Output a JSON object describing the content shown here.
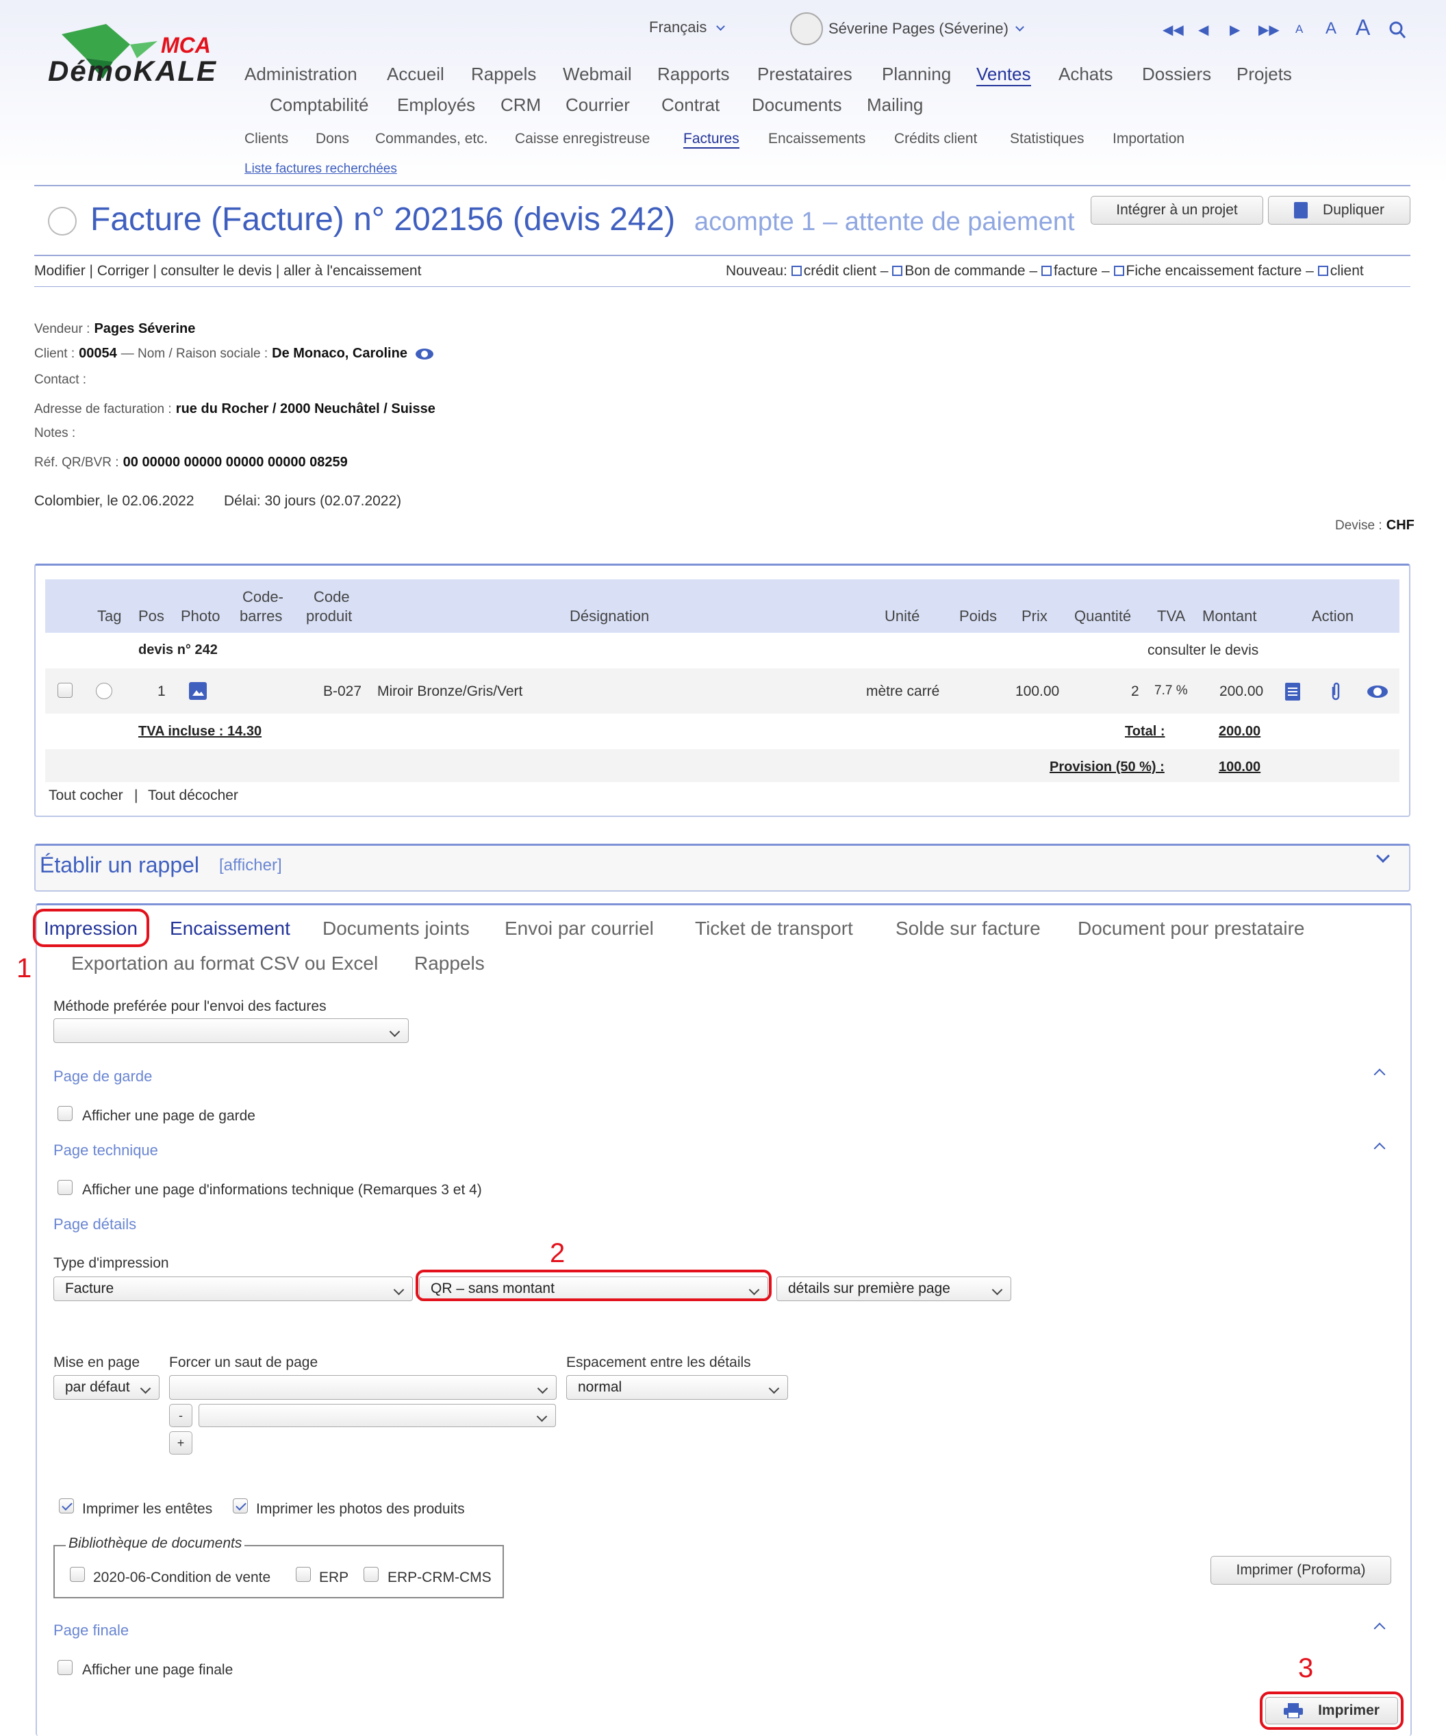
{
  "header": {
    "logo_text": "DémoKALE",
    "logo_badge": "MCA",
    "language": "Français",
    "user": "Séverine Pages (Séverine)",
    "font_sizes": [
      "A",
      "A",
      "A"
    ]
  },
  "main_nav": {
    "row1": [
      "Administration",
      "Accueil",
      "Rappels",
      "Webmail",
      "Rapports",
      "Prestataires",
      "Planning",
      "Ventes",
      "Achats",
      "Dossiers",
      "Projets"
    ],
    "row2": [
      "Comptabilité",
      "Employés",
      "CRM",
      "Courrier",
      "Contrat",
      "Documents",
      "Mailing"
    ],
    "active": "Ventes"
  },
  "sub_nav": {
    "items": [
      "Clients",
      "Dons",
      "Commandes, etc.",
      "Caisse enregistreuse",
      "Factures",
      "Encaissements",
      "Crédits client",
      "Statistiques",
      "Importation"
    ],
    "active": "Factures",
    "link": "Liste factures recherchées"
  },
  "title": {
    "main": "Facture (Facture) n° 202156 (devis 242)",
    "status": "acompte 1 – attente de paiement",
    "btn_project": "Intégrer à un projet",
    "btn_duplicate": "Dupliquer"
  },
  "actions": {
    "left": "Modifier | Corriger | consulter le devis | aller à l'encaissement",
    "nouveau": "Nouveau:",
    "links": [
      "crédit client –",
      "Bon de commande –",
      "facture –",
      "Fiche encaissement facture –",
      "client"
    ]
  },
  "info": {
    "vendeur_lbl": "Vendeur :",
    "vendeur": "Pages Séverine",
    "client_lbl": "Client :",
    "client": "00054",
    "nom_lbl": "— Nom / Raison sociale :",
    "nom": "De Monaco, Caroline",
    "contact_lbl": "Contact :",
    "adresse_lbl": "Adresse de facturation :",
    "adresse": "rue du Rocher / 2000 Neuchâtel / Suisse",
    "notes_lbl": "Notes :",
    "ref_lbl": "Réf. QR/BVR :",
    "ref": "00 00000 00000 00000 00000 08259",
    "date": "Colombier, le 02.06.2022",
    "delai": "Délai: 30 jours (02.07.2022)",
    "devise_lbl": "Devise :",
    "devise": "CHF"
  },
  "table": {
    "headers": {
      "tag": "Tag",
      "pos": "Pos",
      "photo": "Photo",
      "code_barres_1": "Code-",
      "code_barres_2": "barres",
      "code_produit_1": "Code",
      "code_produit_2": "produit",
      "designation": "Désignation",
      "unite": "Unité",
      "poids": "Poids",
      "prix": "Prix",
      "quantite": "Quantité",
      "tva": "TVA",
      "montant": "Montant",
      "action": "Action"
    },
    "group_label": "devis n° 242",
    "group_link": "consulter le devis",
    "row": {
      "pos": "1",
      "code": "B-027",
      "designation": "Miroir Bronze/Gris/Vert",
      "unite": "mètre carré",
      "prix": "100.00",
      "quantite": "2",
      "tva": "7.7 %",
      "montant": "200.00"
    },
    "tva_incluse": "TVA incluse : 14.30",
    "total_lbl": "Total :",
    "total": "200.00",
    "provision_lbl": "Provision (50 %) :",
    "provision": "100.00",
    "check_all": "Tout cocher",
    "uncheck_all": "Tout décocher"
  },
  "rappel": {
    "title": "Établir un rappel",
    "link": "[afficher]"
  },
  "tabs": {
    "row1": [
      "Impression",
      "Encaissement",
      "Documents joints",
      "Envoi par courriel",
      "Ticket de transport",
      "Solde sur facture",
      "Document pour prestataire"
    ],
    "row2": [
      "Exportation au format CSV ou Excel",
      "Rappels"
    ],
    "active": "Impression"
  },
  "form": {
    "methode_lbl": "Méthode preférée pour l'envoi des factures",
    "page_garde": "Page de garde",
    "page_garde_cb": "Afficher une page de garde",
    "page_tech": "Page technique",
    "page_tech_cb": "Afficher une page d'informations technique (Remarques 3 et 4)",
    "page_details": "Page détails",
    "type_lbl": "Type d'impression",
    "type_val": "Facture",
    "qr_val": "QR – sans montant",
    "details_val": "détails sur première page",
    "mise_lbl": "Mise en page",
    "mise_val": "par défaut",
    "saut_lbl": "Forcer un saut de page",
    "espace_lbl": "Espacement entre les détails",
    "espace_val": "normal",
    "minus": "-",
    "plus": "+",
    "entetes": "Imprimer les entêtes",
    "photos": "Imprimer les photos des produits",
    "biblio": "Bibliothèque de documents",
    "biblio_items": [
      "2020-06-Condition de vente",
      "ERP",
      "ERP-CRM-CMS"
    ],
    "proforma": "Imprimer (Proforma)",
    "page_finale": "Page finale",
    "page_finale_cb": "Afficher une page finale",
    "imprimer": "Imprimer"
  },
  "annotations": [
    "1",
    "2",
    "3"
  ],
  "colors": {
    "accent": "#3f5fbf",
    "nav_active": "#23349a",
    "highlight": "#e3111b"
  }
}
